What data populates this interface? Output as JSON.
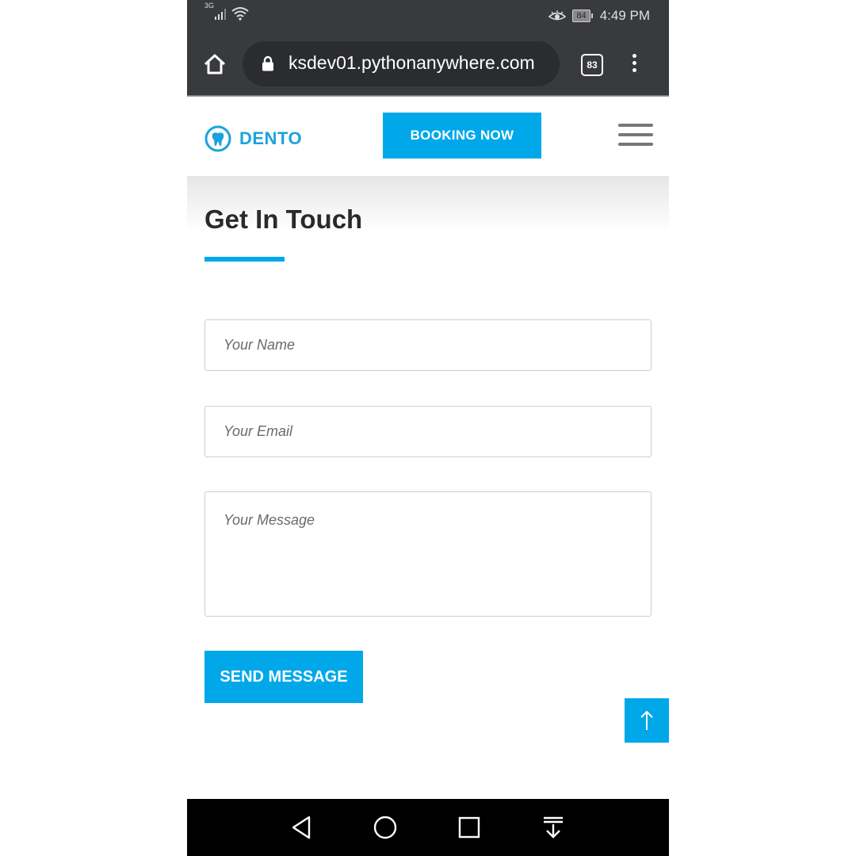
{
  "status_bar": {
    "network": "3G",
    "battery": "84",
    "time": "4:49 PM"
  },
  "browser": {
    "url": "ksdev01.pythonanywhere.com",
    "tab_count": "83"
  },
  "header": {
    "logo_text": "DENTO",
    "booking_label": "BOOKING NOW"
  },
  "content": {
    "title": "Get In Touch",
    "name_placeholder": "Your Name",
    "email_placeholder": "Your Email",
    "message_placeholder": "Your Message",
    "send_label": "SEND MESSAGE"
  },
  "colors": {
    "accent": "#00a8ea",
    "status_bar": "#393a3d"
  },
  "icons": [
    "signal-icon",
    "wifi-icon",
    "eye-icon",
    "battery-icon",
    "home-icon",
    "lock-icon",
    "tabs-icon",
    "more-icon",
    "tooth-logo-icon",
    "hamburger-icon",
    "arrow-up-icon",
    "back-icon",
    "home-circle-icon",
    "recents-icon",
    "notifications-icon"
  ]
}
